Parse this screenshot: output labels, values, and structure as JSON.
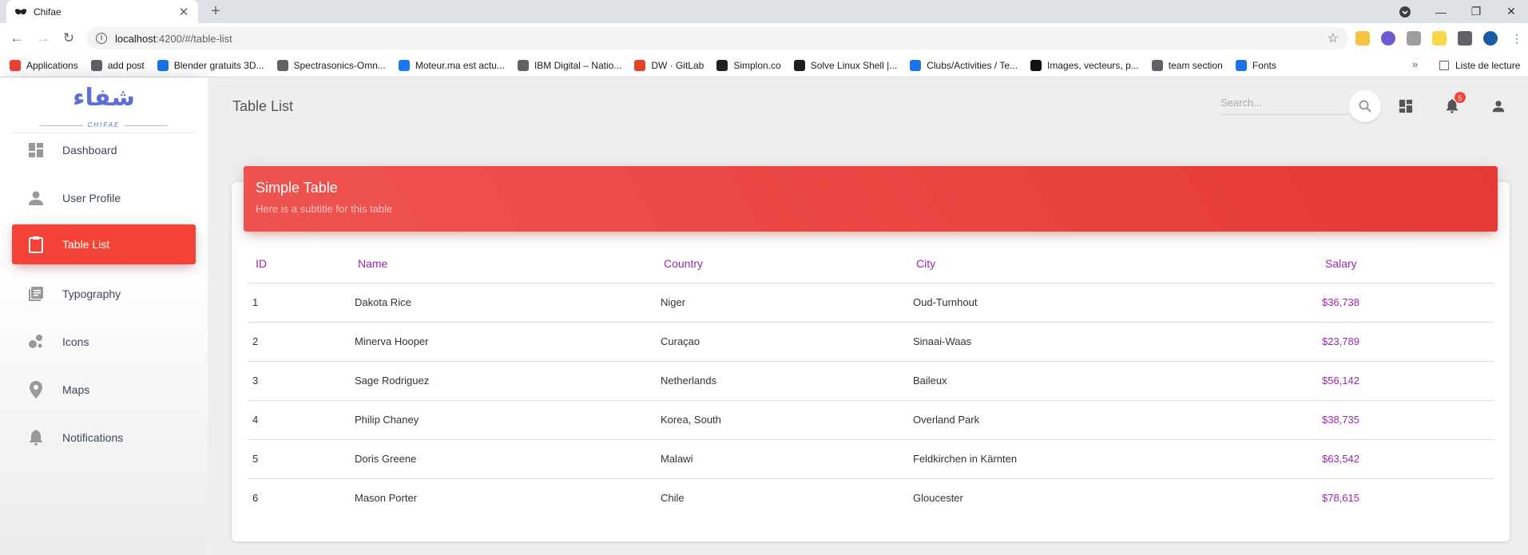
{
  "browser": {
    "tab_title": "Chifae",
    "url_host": "localhost",
    "url_path": ":4200/#/table-list",
    "bookmarks": [
      {
        "label": "Applications",
        "color": "#ea4335"
      },
      {
        "label": "add post",
        "color": "#5f6368"
      },
      {
        "label": "Blender gratuits 3D...",
        "color": "#1a73e8"
      },
      {
        "label": "Spectrasonics-Omn...",
        "color": "#5f6368"
      },
      {
        "label": "Moteur.ma est actu...",
        "color": "#1877f2"
      },
      {
        "label": "IBM Digital – Natio...",
        "color": "#5f6368"
      },
      {
        "label": "DW · GitLab",
        "color": "#e24329"
      },
      {
        "label": "Simplon.co",
        "color": "#202124"
      },
      {
        "label": "Solve Linux Shell |...",
        "color": "#1e1e1e"
      },
      {
        "label": "Clubs/Activities / Te...",
        "color": "#1a73e8"
      },
      {
        "label": "Images, vecteurs, p...",
        "color": "#111111"
      },
      {
        "label": "team section",
        "color": "#5f6368"
      },
      {
        "label": "Fonts",
        "color": "#1a73e8"
      }
    ],
    "reading_list": "Liste de lecture"
  },
  "sidebar": {
    "logo_arabic": "شفاء",
    "logo_sub": "CHIFAE",
    "items": [
      {
        "label": "Dashboard",
        "icon": "dashboard-icon"
      },
      {
        "label": "User Profile",
        "icon": "person-icon"
      },
      {
        "label": "Table List",
        "icon": "clipboard-icon",
        "active": true
      },
      {
        "label": "Typography",
        "icon": "library-books-icon"
      },
      {
        "label": "Icons",
        "icon": "bubble-chart-icon"
      },
      {
        "label": "Maps",
        "icon": "location-icon"
      },
      {
        "label": "Notifications",
        "icon": "bell-icon"
      }
    ]
  },
  "header": {
    "title": "Table List",
    "search_placeholder": "Search...",
    "notification_count": "5"
  },
  "card": {
    "title": "Simple Table",
    "subtitle": "Here is a subtitle for this table",
    "columns": [
      "ID",
      "Name",
      "Country",
      "City",
      "Salary"
    ],
    "rows": [
      [
        "1",
        "Dakota Rice",
        "Niger",
        "Oud-Turnhout",
        "$36,738"
      ],
      [
        "2",
        "Minerva Hooper",
        "Curaçao",
        "Sinaai-Waas",
        "$23,789"
      ],
      [
        "3",
        "Sage Rodriguez",
        "Netherlands",
        "Baileux",
        "$56,142"
      ],
      [
        "4",
        "Philip Chaney",
        "Korea, South",
        "Overland Park",
        "$38,735"
      ],
      [
        "5",
        "Doris Greene",
        "Malawi",
        "Feldkirchen in Kärnten",
        "$63,542"
      ],
      [
        "6",
        "Mason Porter",
        "Chile",
        "Gloucester",
        "$78,615"
      ]
    ]
  },
  "colors": {
    "accent": "#f44336",
    "table_header": "#9c27b0",
    "logo": "#5b6fd6"
  }
}
